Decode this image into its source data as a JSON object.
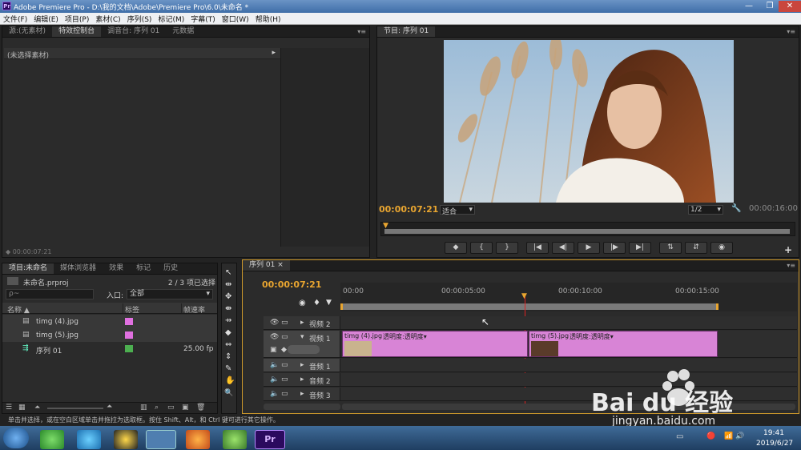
{
  "window": {
    "title": "Adobe Premiere Pro - D:\\我的文档\\Adobe\\Premiere Pro\\6.0\\未命名 *",
    "app_icon": "Pr",
    "min_glyph": "—",
    "max_glyph": "❐",
    "close_glyph": "✕"
  },
  "menu": [
    "文件(F)",
    "编辑(E)",
    "项目(P)",
    "素材(C)",
    "序列(S)",
    "标记(M)",
    "字幕(T)",
    "窗口(W)",
    "帮助(H)"
  ],
  "source_panel": {
    "tabs": [
      "源:(无素材)",
      "特效控制台",
      "调音台: 序列 01",
      "元数据"
    ],
    "active_tab": 1,
    "no_clip_label": "(未选择素材)",
    "timecode": "00:00:07:21"
  },
  "program_panel": {
    "tab": "节目: 序列 01",
    "timecode_current": "00:00:07:21",
    "fit": "适合",
    "resolution": "1/2",
    "duration": "00:00:16:00",
    "controls": [
      "◆",
      "{",
      "}",
      "|◀",
      "◀|",
      "▶",
      "|▶",
      "▶|",
      "⇅",
      "⇵",
      "◉"
    ],
    "add": "+"
  },
  "project_panel": {
    "tabs": [
      "项目:未命名",
      "媒体浏览器",
      "效果",
      "标记",
      "历史"
    ],
    "project_file": "未命名.prproj",
    "selected_count": "2 / 3 项已选择",
    "search_placeholder": "ρ~",
    "in_label": "入口:",
    "in_value": "全部",
    "columns": [
      "名称",
      "标签",
      "帧速率"
    ],
    "items": [
      {
        "name": "timg (4).jpg",
        "label_color": "#e070e0",
        "fps": ""
      },
      {
        "name": "timg (5).jpg",
        "label_color": "#e070e0",
        "fps": ""
      },
      {
        "name": "序列 01",
        "label_color": "#4caf50",
        "fps": "25.00 fp"
      }
    ]
  },
  "tools": [
    "↖",
    "⇹",
    "✥",
    "⇼",
    "⇸",
    "◆",
    "⇔",
    "⇕",
    "✎",
    "✋",
    "🔍"
  ],
  "timeline": {
    "tab": "序列 01",
    "timecode": "00:00:07:21",
    "ruler": [
      "00:00",
      "00:00:05:00",
      "00:00:10:00",
      "00:00:15:00"
    ],
    "tracks": [
      {
        "name": "视频 2",
        "type": "video"
      },
      {
        "name": "视频 1",
        "type": "video"
      },
      {
        "name": "音频 1",
        "type": "audio"
      },
      {
        "name": "音频 2",
        "type": "audio"
      },
      {
        "name": "音频 3",
        "type": "audio"
      }
    ],
    "clips": [
      {
        "name": "timg (4).jpg",
        "fx": "透明度:透明度▾"
      },
      {
        "name": "timg (5).jpg",
        "fx": "透明度:透明度▾"
      }
    ]
  },
  "status_bar": "单击并选择，或在空白区域单击并拖拉为选取框。按住 Shift、Alt，和 Ctrl 键可进行其它操作。",
  "taskbar": {
    "time": "19:41",
    "date": "2019/6/27",
    "apps": [
      "start",
      "360",
      "media",
      "qq",
      "explorer",
      "firefox",
      "camtasia",
      "premiere"
    ],
    "tray": [
      "▭",
      "🔴",
      "📶",
      "🔊",
      "🚩"
    ]
  },
  "watermark": {
    "text": "Bai du 经验",
    "url": "jingyan.baidu.com"
  },
  "colors": {
    "accent": "#e8a530",
    "clip": "#d884d6",
    "playhead": "#d22"
  }
}
